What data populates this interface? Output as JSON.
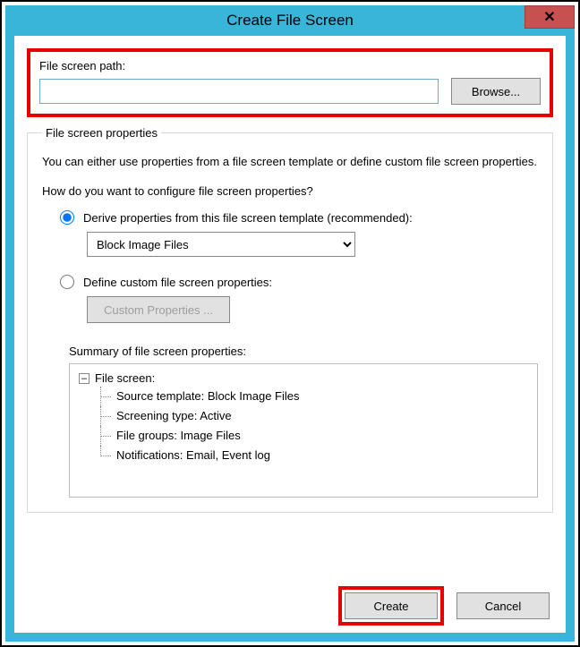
{
  "window": {
    "title": "Create File Screen",
    "close_glyph": "✕"
  },
  "path": {
    "label": "File screen path:",
    "value": "",
    "browse_label": "Browse..."
  },
  "props": {
    "legend": "File screen properties",
    "intro": "You can either use properties from a file screen template or define custom file screen properties.",
    "question": "How do you want to configure file screen properties?",
    "option_template": "Derive properties from this file screen template (recommended):",
    "template_selected": "Block Image Files",
    "option_custom": "Define custom file screen properties:",
    "custom_btn": "Custom Properties ...",
    "summary_label": "Summary of file screen properties:",
    "tree": {
      "toggle": "–",
      "root": "File screen:",
      "items": [
        "Source template: Block Image Files",
        "Screening type: Active",
        "File groups: Image Files",
        "Notifications: Email, Event log"
      ]
    }
  },
  "footer": {
    "create": "Create",
    "cancel": "Cancel"
  }
}
